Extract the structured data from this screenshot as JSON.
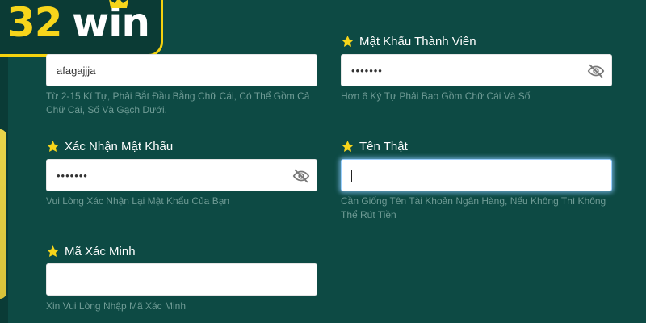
{
  "brand": {
    "number": "32",
    "word": "win"
  },
  "fields": {
    "username": {
      "value": "afagajjja",
      "hint": "Từ 2-15 Kí Tự, Phải Bắt Đầu Bằng Chữ Cái, Có Thể Gồm Cả Chữ Cái, Số Và Gạch Dưới."
    },
    "password": {
      "label": "Mật Khẩu Thành Viên",
      "value": "•••••••",
      "hint": "Hơn 6 Ký Tự Phải Bao Gồm Chữ Cái Và Số"
    },
    "confirm_password": {
      "label": "Xác Nhận Mật Khẩu",
      "value": "•••••••",
      "hint": "Vui Lòng Xác Nhận Lại Mật Khẩu Của Bạn"
    },
    "real_name": {
      "label": "Tên Thật",
      "value": "",
      "hint": "Cần Giống Tên Tài Khoản Ngân Hàng, Nếu Không Thì Không Thể Rút Tiền"
    },
    "verification_code": {
      "label": "Mã Xác Minh",
      "value": "",
      "hint": "Xin Vui Lòng Nhập Mã Xác Minh"
    }
  },
  "colors": {
    "background": "#0d4a44",
    "accent": "#f7d51b",
    "hint": "#6f9b95"
  },
  "icons": {
    "required": "star-icon",
    "toggle": "eye-off-icon"
  }
}
